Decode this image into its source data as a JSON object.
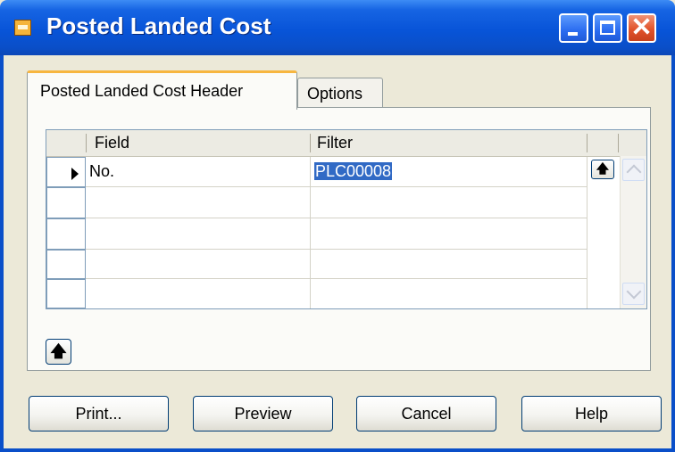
{
  "window": {
    "title": "Posted Landed Cost"
  },
  "tabs": [
    {
      "label": "Posted Landed Cost Header",
      "active": true
    },
    {
      "label": "Options",
      "active": false
    }
  ],
  "grid": {
    "columns": [
      "Field",
      "Filter"
    ],
    "rows": [
      {
        "field": "No.",
        "filter": "PLC00008",
        "current": true
      },
      {
        "field": "",
        "filter": ""
      },
      {
        "field": "",
        "filter": ""
      },
      {
        "field": "",
        "filter": ""
      },
      {
        "field": "",
        "filter": ""
      }
    ]
  },
  "icons": {
    "assist": "up-arrow-icon",
    "current_row": "triangle-right-icon",
    "window": "app-icon"
  },
  "buttons": {
    "print": "Print...",
    "preview": "Preview",
    "cancel": "Cancel",
    "help": "Help"
  },
  "colors": {
    "titlebar": "#0a4fc9",
    "selection": "#316ac5",
    "tab_highlight": "#f7b640",
    "close": "#e1532b"
  }
}
